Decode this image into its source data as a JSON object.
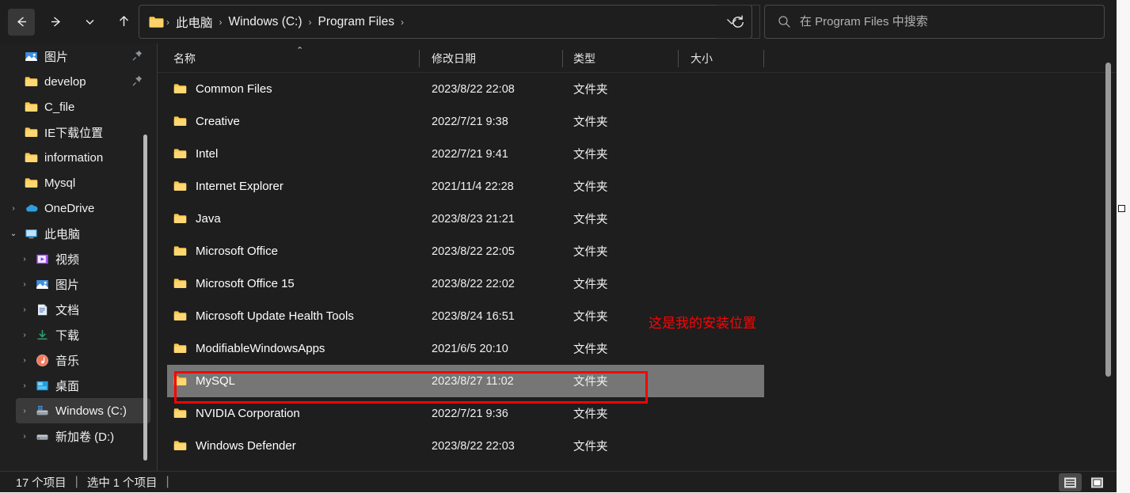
{
  "nav": {
    "back_label": "←",
    "forward_label": "→",
    "recent_label": "⌄",
    "up_label": "↑",
    "refresh_label": "refresh-icon",
    "breadcrumb_caret": "⌄"
  },
  "breadcrumb": {
    "folder_icon": "folder-icon",
    "items": [
      "此电脑",
      "Windows (C:)",
      "Program Files"
    ],
    "separator": "›",
    "trailing_separator": "›"
  },
  "search": {
    "icon": "search-icon",
    "placeholder": "在 Program Files 中搜索",
    "value": ""
  },
  "sidebar": {
    "items": [
      {
        "label": "图片",
        "icon": "pictures-icon",
        "chevron": "",
        "pinned": true,
        "indent": 0,
        "selected": false
      },
      {
        "label": "develop",
        "icon": "folder-icon",
        "chevron": "",
        "pinned": true,
        "indent": 0,
        "selected": false
      },
      {
        "label": "C_file",
        "icon": "folder-icon",
        "chevron": "",
        "pinned": false,
        "indent": 0,
        "selected": false
      },
      {
        "label": "IE下载位置",
        "icon": "folder-icon",
        "chevron": "",
        "pinned": false,
        "indent": 0,
        "selected": false
      },
      {
        "label": "information",
        "icon": "folder-icon",
        "chevron": "",
        "pinned": false,
        "indent": 0,
        "selected": false
      },
      {
        "label": "Mysql",
        "icon": "folder-icon",
        "chevron": "",
        "pinned": false,
        "indent": 0,
        "selected": false
      },
      {
        "label": "OneDrive",
        "icon": "onedrive-cloud-icon",
        "chevron": "›",
        "pinned": false,
        "indent": 0,
        "selected": false
      },
      {
        "label": "此电脑",
        "icon": "this-pc-monitor-icon",
        "chevron": "⌄",
        "pinned": false,
        "indent": 0,
        "selected": false
      },
      {
        "label": "视频",
        "icon": "videos-icon",
        "chevron": "›",
        "pinned": false,
        "indent": 1,
        "selected": false
      },
      {
        "label": "图片",
        "icon": "pictures-icon",
        "chevron": "›",
        "pinned": false,
        "indent": 1,
        "selected": false
      },
      {
        "label": "文档",
        "icon": "documents-icon",
        "chevron": "›",
        "pinned": false,
        "indent": 1,
        "selected": false
      },
      {
        "label": "下载",
        "icon": "downloads-icon",
        "chevron": "›",
        "pinned": false,
        "indent": 1,
        "selected": false
      },
      {
        "label": "音乐",
        "icon": "music-icon",
        "chevron": "›",
        "pinned": false,
        "indent": 1,
        "selected": false
      },
      {
        "label": "桌面",
        "icon": "desktop-icon",
        "chevron": "›",
        "pinned": false,
        "indent": 1,
        "selected": false
      },
      {
        "label": "Windows (C:)",
        "icon": "system-drive-icon",
        "chevron": "›",
        "pinned": false,
        "indent": 1,
        "selected": true
      },
      {
        "label": "新加卷 (D:)",
        "icon": "drive-icon",
        "chevron": "›",
        "pinned": false,
        "indent": 1,
        "selected": false
      }
    ]
  },
  "columns": {
    "name": "名称",
    "date": "修改日期",
    "type": "类型",
    "size": "大小",
    "sort_caret": "⌃"
  },
  "files": [
    {
      "name": "Common Files",
      "date": "2023/8/22 22:08",
      "type": "文件夹",
      "size": "",
      "selected": false
    },
    {
      "name": "Creative",
      "date": "2022/7/21 9:38",
      "type": "文件夹",
      "size": "",
      "selected": false
    },
    {
      "name": "Intel",
      "date": "2022/7/21 9:41",
      "type": "文件夹",
      "size": "",
      "selected": false
    },
    {
      "name": "Internet Explorer",
      "date": "2021/11/4 22:28",
      "type": "文件夹",
      "size": "",
      "selected": false
    },
    {
      "name": "Java",
      "date": "2023/8/23 21:21",
      "type": "文件夹",
      "size": "",
      "selected": false
    },
    {
      "name": "Microsoft Office",
      "date": "2023/8/22 22:05",
      "type": "文件夹",
      "size": "",
      "selected": false
    },
    {
      "name": "Microsoft Office 15",
      "date": "2023/8/22 22:02",
      "type": "文件夹",
      "size": "",
      "selected": false
    },
    {
      "name": "Microsoft Update Health Tools",
      "date": "2023/8/24 16:51",
      "type": "文件夹",
      "size": "",
      "selected": false
    },
    {
      "name": "ModifiableWindowsApps",
      "date": "2021/6/5 20:10",
      "type": "文件夹",
      "size": "",
      "selected": false
    },
    {
      "name": "MySQL",
      "date": "2023/8/27 11:02",
      "type": "文件夹",
      "size": "",
      "selected": true
    },
    {
      "name": "NVIDIA Corporation",
      "date": "2022/7/21 9:36",
      "type": "文件夹",
      "size": "",
      "selected": false
    },
    {
      "name": "Windows Defender",
      "date": "2023/8/22 22:03",
      "type": "文件夹",
      "size": "",
      "selected": false
    }
  ],
  "annotation": {
    "text": "这是我的安装位置",
    "color": "#fb0505"
  },
  "highlight": {
    "color": "#fe0000",
    "target": "MySQL"
  },
  "status": {
    "item_count": "17 个项目",
    "separator": "|",
    "selected_count": "选中 1 个项目",
    "trailing_separator": "|"
  },
  "view_buttons": [
    {
      "icon": "details-view-icon",
      "active": true
    },
    {
      "icon": "large-icons-view-icon",
      "active": false
    }
  ]
}
